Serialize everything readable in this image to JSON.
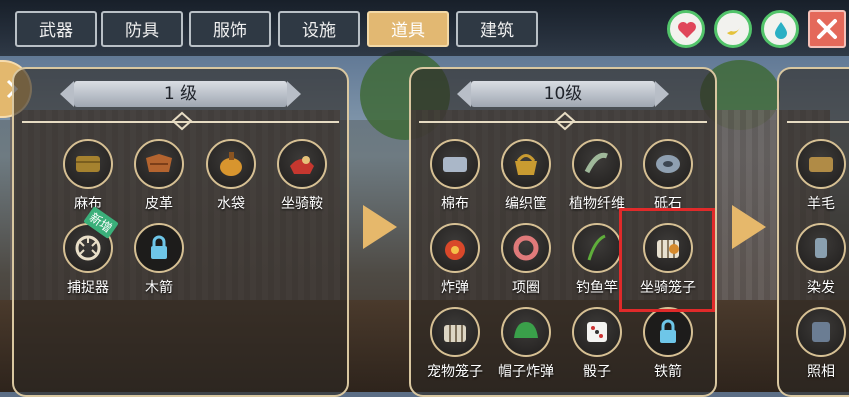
{
  "tabs": [
    {
      "label": "武器",
      "active": false
    },
    {
      "label": "防具",
      "active": false
    },
    {
      "label": "服饰",
      "active": false
    },
    {
      "label": "设施",
      "active": false
    },
    {
      "label": "道具",
      "active": true
    },
    {
      "label": "建筑",
      "active": false
    }
  ],
  "status_buttons": [
    {
      "icon": "heart-icon",
      "color": "#e0465a"
    },
    {
      "icon": "banana-icon",
      "color": "#e4c23a"
    },
    {
      "icon": "water-drop-icon",
      "color": "#2ab0c4"
    }
  ],
  "close_icon": "close-icon",
  "panels": [
    {
      "title": "1  级",
      "items": [
        {
          "name": "麻布",
          "icon": "linen-icon",
          "new": false
        },
        {
          "name": "皮革",
          "icon": "leather-icon",
          "new": false
        },
        {
          "name": "水袋",
          "icon": "water-bag-icon",
          "new": false
        },
        {
          "name": "坐骑鞍",
          "icon": "saddle-icon",
          "new": false
        },
        {
          "name": "捕捉器",
          "icon": "trap-icon",
          "new": true
        },
        {
          "name": "木箭",
          "icon": "lock-icon",
          "new": false
        }
      ]
    },
    {
      "title": "10级",
      "items": [
        {
          "name": "棉布",
          "icon": "cotton-cloth-icon"
        },
        {
          "name": "编织筐",
          "icon": "woven-basket-icon"
        },
        {
          "name": "植物纤维",
          "icon": "plant-fiber-icon"
        },
        {
          "name": "砥石",
          "icon": "whetstone-icon"
        },
        {
          "name": "炸弹",
          "icon": "bomb-icon"
        },
        {
          "name": "项圈",
          "icon": "collar-icon"
        },
        {
          "name": "钓鱼竿",
          "icon": "fishing-rod-icon"
        },
        {
          "name": "坐骑笼子",
          "icon": "mount-cage-icon",
          "highlighted": true
        },
        {
          "name": "宠物笼子",
          "icon": "pet-cage-icon"
        },
        {
          "name": "帽子炸弹",
          "icon": "hat-bomb-icon"
        },
        {
          "name": "骰子",
          "icon": "dice-icon"
        },
        {
          "name": "铁箭",
          "icon": "lock-icon"
        }
      ]
    },
    {
      "title": "",
      "items": [
        {
          "name": "羊毛",
          "icon": "wool-icon"
        },
        {
          "name": "染发",
          "icon": "hair-dye-icon"
        },
        {
          "name": "照相",
          "icon": "camera-icon"
        }
      ]
    }
  ],
  "new_badge_label": "新增"
}
